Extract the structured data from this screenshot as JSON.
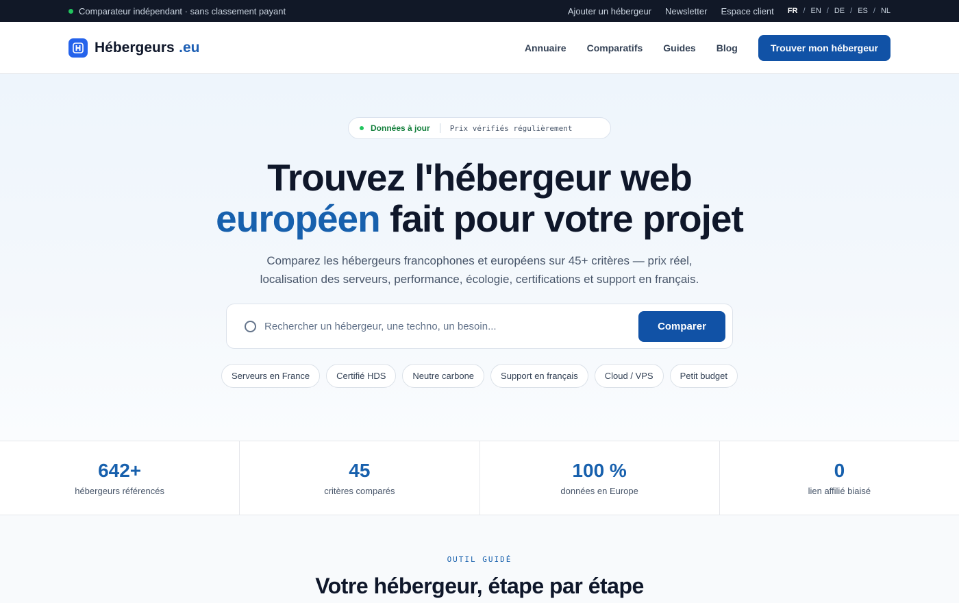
{
  "topbar": {
    "tagline": "Comparateur indépendant · sans classement payant",
    "links": [
      "Ajouter un hébergeur",
      "Newsletter",
      "Espace client"
    ],
    "languages": [
      "FR",
      "EN",
      "DE",
      "ES",
      "NL"
    ],
    "active_language": "FR"
  },
  "header": {
    "brand_name": "Hébergeurs",
    "brand_tld": ".eu",
    "logo_icon": "h-logo-icon",
    "nav": [
      "Annuaire",
      "Comparatifs",
      "Guides",
      "Blog"
    ],
    "cta_label": "Trouver mon hébergeur"
  },
  "hero": {
    "pill_status": "Données à jour",
    "pill_note": "Prix vérifiés régulièrement",
    "title_line1": "Trouvez l'hébergeur web",
    "title_accent": "européen",
    "title_line2_rest": " fait pour votre projet",
    "subtitle": "Comparez les hébergeurs francophones et européens sur 45+ critères — prix réel, localisation des serveurs, performance, écologie, certifications et support en français.",
    "search_placeholder": "Rechercher un hébergeur, une techno, un besoin...",
    "search_button": "Comparer",
    "chips": [
      "Serveurs en France",
      "Certifié HDS",
      "Neutre carbone",
      "Support en français",
      "Cloud / VPS",
      "Petit budget"
    ]
  },
  "stats": [
    {
      "value": "642+",
      "label": "hébergeurs référencés"
    },
    {
      "value": "45",
      "label": "critères comparés"
    },
    {
      "value": "100 %",
      "label": "données en Europe"
    },
    {
      "value": "0",
      "label": "lien affilié biaisé"
    }
  ],
  "tool_section": {
    "eyebrow": "OUTIL GUIDÉ",
    "title": "Votre hébergeur, étape par étape"
  },
  "colors": {
    "accent": "#1760ad",
    "button": "#1152a6",
    "topbar_bg": "#111827",
    "success": "#22c55e"
  }
}
